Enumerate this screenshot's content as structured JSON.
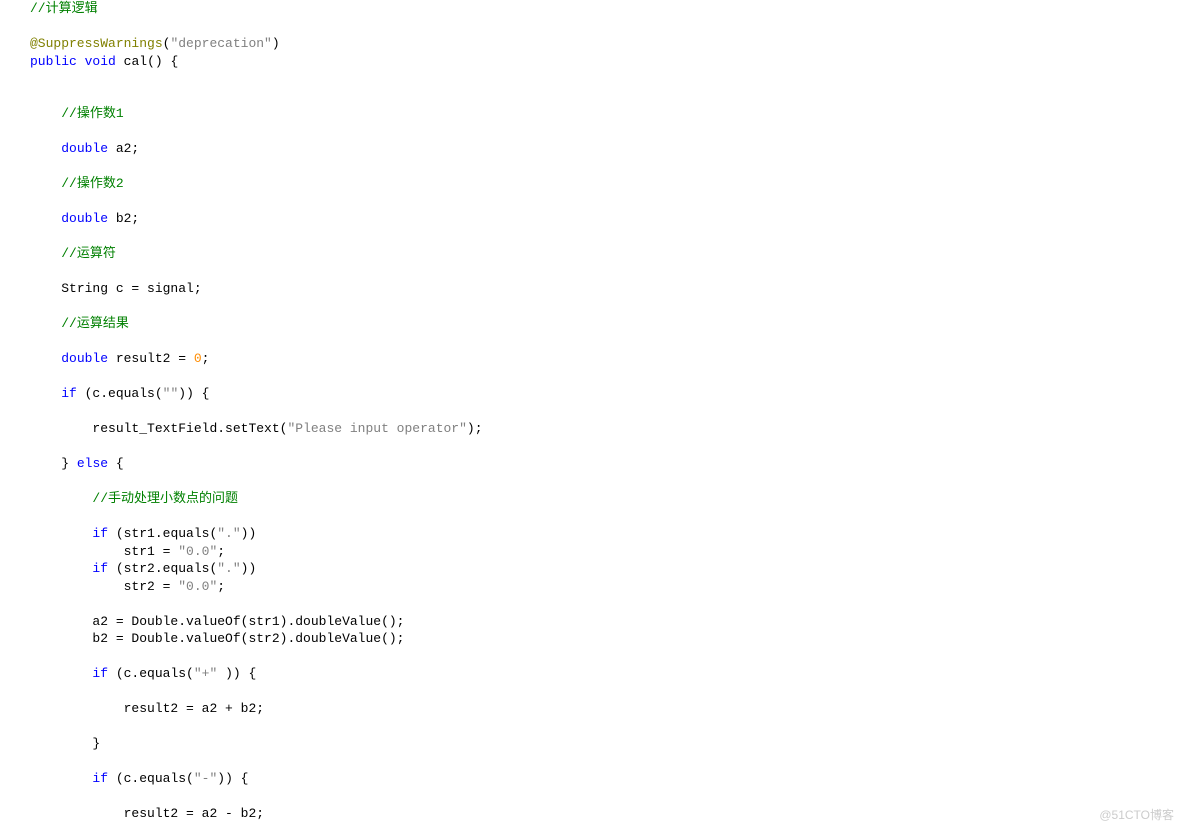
{
  "code": {
    "c1": "//计算逻辑",
    "annotation_at": "@SuppressWarnings",
    "annotation_paren_open": "(",
    "annotation_str": "\"deprecation\"",
    "annotation_paren_close": ")",
    "kw_public": "public",
    "kw_void": "void",
    "fn_cal": " cal",
    "sig_open": "()",
    "brace_open": " {",
    "c_op1": "//操作数1",
    "kw_double1": "double",
    "var_a2": " a2;",
    "c_op2": "//操作数2",
    "kw_double2": "double",
    "var_b2": " b2;",
    "c_opsym": "//运算符",
    "line_string_c": "String c = signal;",
    "c_result": "//运算结果",
    "kw_double3": "double",
    "line_result2": " result2 = ",
    "num_zero": "0",
    "semi": ";",
    "kw_if1": "if",
    "if1_cond_a": " (c.equals(",
    "str_empty": "\"\"",
    "if1_cond_b": ")) {",
    "line_setText_a": "result_TextField.setText(",
    "str_please": "\"Please input operator\"",
    "line_setText_b": ");",
    "brace_close1": "}",
    "kw_else": "else",
    "else_open": " {",
    "c_manual": "//手动处理小数点的问题",
    "kw_if2": "if",
    "if2_cond_a": " (str1.equals(",
    "str_dot1": "\".\"",
    "if2_cond_b": "))",
    "line_str1_a": "str1 = ",
    "str_zerozero1": "\"0.0\"",
    "kw_if3": "if",
    "if3_cond_a": " (str2.equals(",
    "str_dot2": "\".\"",
    "if3_cond_b": "))",
    "line_str2_a": "str2 = ",
    "str_zerozero2": "\"0.0\"",
    "line_a2val": "a2 = Double.valueOf(str1).doubleValue();",
    "line_b2val": "b2 = Double.valueOf(str2).doubleValue();",
    "kw_if4": "if",
    "if4_cond_a": " (c.equals(",
    "str_plus": "\"+\"",
    "if4_cond_b": " )) {",
    "line_add": "result2 = a2 + b2;",
    "brace_close2": "}",
    "kw_if5": "if",
    "if5_cond_a": " (c.equals(",
    "str_minus": "\"-\"",
    "if5_cond_b": ")) {",
    "line_sub": "result2 = a2 - b2;"
  },
  "watermark": "@51CTO博客"
}
